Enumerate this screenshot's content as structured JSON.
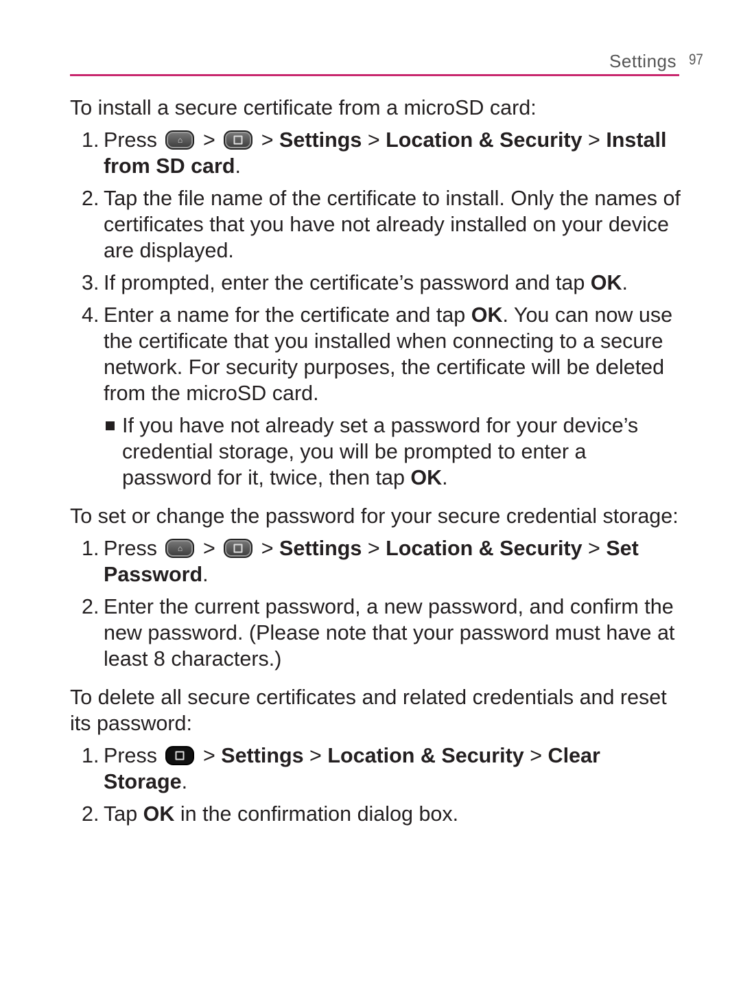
{
  "header": {
    "title": "Settings",
    "page_number": "97",
    "accent_color": "#c8286e"
  },
  "sections": [
    {
      "heading": "To install a secure certificate from a microSD card:",
      "steps": [
        {
          "num": "1.",
          "pre": "Press",
          "sep": ">",
          "path": [
            "Settings",
            "Location & Security",
            "Install from SD card"
          ],
          "end": "."
        },
        {
          "num": "2.",
          "text": "Tap the file name of the certificate to install. Only the names of certificates that you have not already installed on your device are displayed."
        },
        {
          "num": "3.",
          "text": "If prompted, enter the certificate’s password and tap ",
          "bold": "OK",
          "end": "."
        },
        {
          "num": "4.",
          "text": "Enter a name for the certificate and tap ",
          "bold": "OK",
          "rest": ". You can now use the certificate that you installed when connecting to a secure network. For security purposes, the certificate will be deleted from the microSD card."
        }
      ],
      "note": {
        "text": "If you have not already set a password for your device’s credential storage, you will be prompted to enter a password for it, twice, then tap ",
        "bold": "OK",
        "end": "."
      }
    },
    {
      "heading": "To set or change the password for your secure credential storage:",
      "steps": [
        {
          "num": "1.",
          "pre": "Press",
          "sep": ">",
          "path": [
            "Settings",
            "Location & Security",
            "Set Password"
          ],
          "end": "."
        },
        {
          "num": "2.",
          "text": "Enter the current password, a new password, and confirm the new password. (Please note that your password must have at least 8 characters.)"
        }
      ]
    },
    {
      "heading": "To delete all secure certificates and related credentials and reset its password:",
      "steps": [
        {
          "num": "1.",
          "pre": "Press",
          "sep": ">",
          "path": [
            "Settings",
            "Location & Security",
            "Clear Storage"
          ],
          "end": "."
        },
        {
          "num": "2.",
          "pre": "Tap ",
          "bold": "OK",
          "text": " in the confirmation dialog box."
        }
      ]
    }
  ],
  "icons": {
    "home_key": "home-key-icon",
    "menu_key": "menu-key-icon"
  }
}
